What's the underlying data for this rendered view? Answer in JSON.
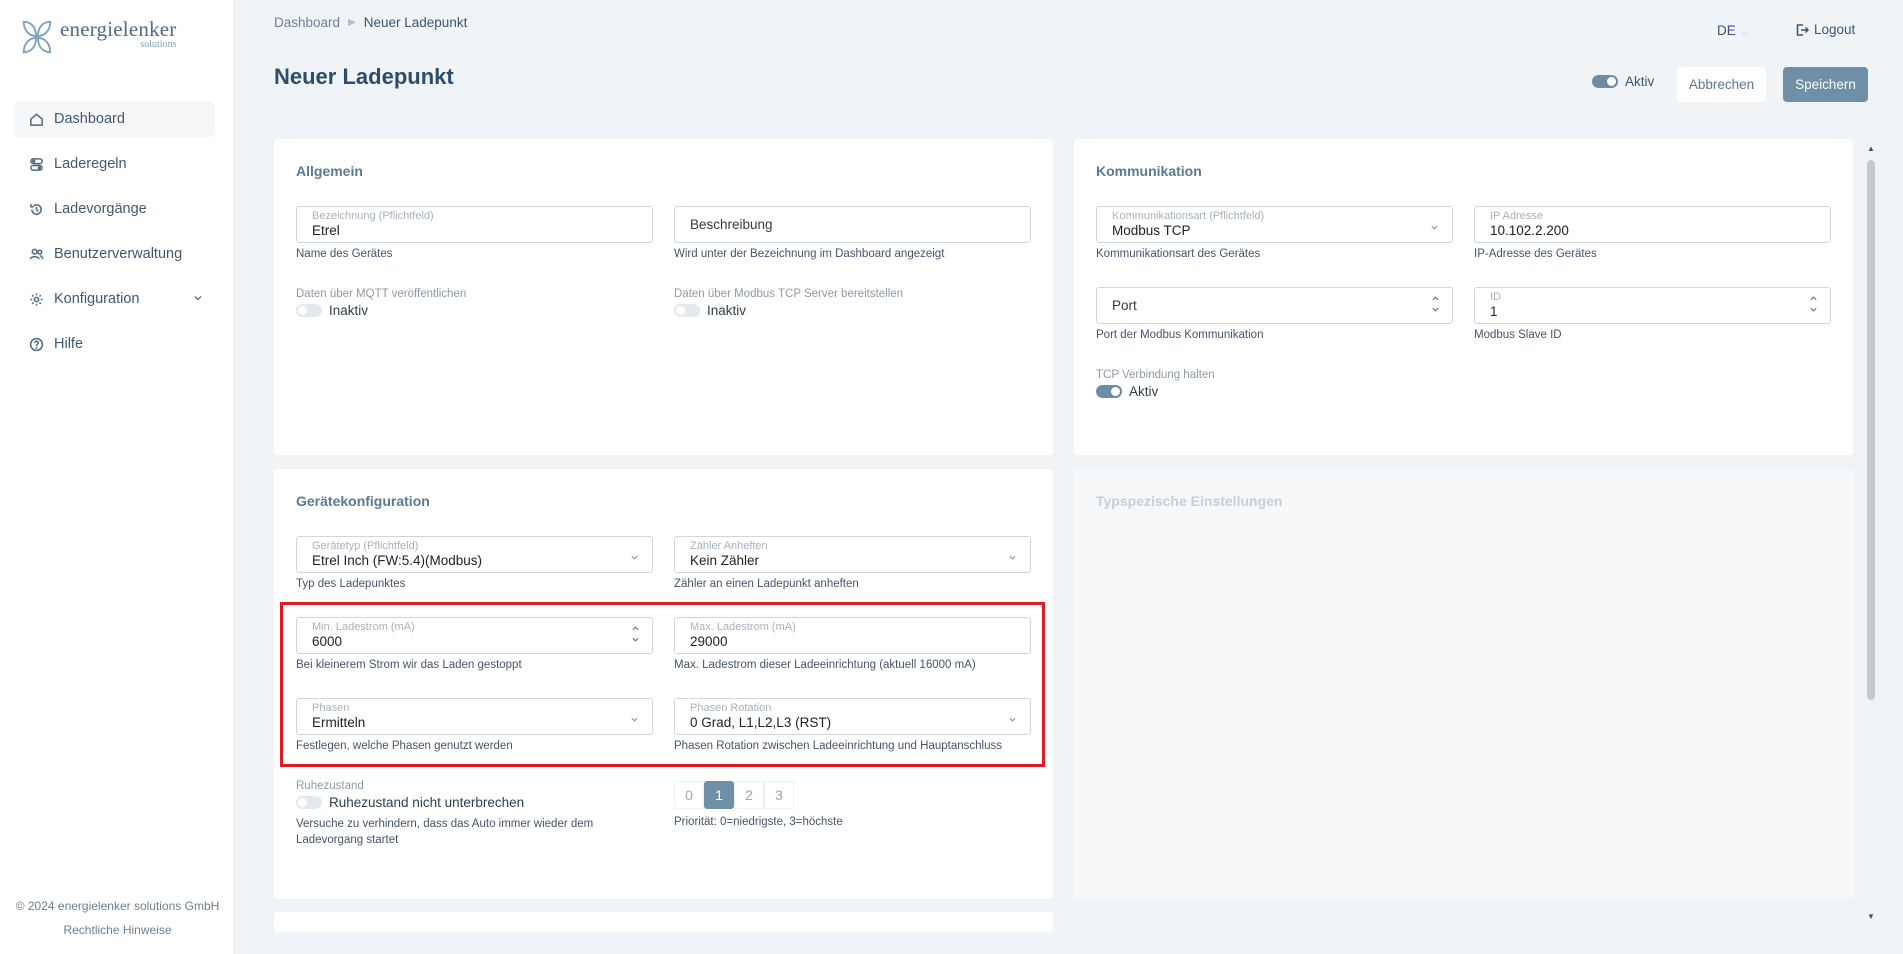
{
  "brand": {
    "name": "energielenker",
    "sub": "solutions"
  },
  "nav": [
    {
      "label": "Dashboard",
      "icon": "home-icon"
    },
    {
      "label": "Laderegeln",
      "icon": "rules-icon"
    },
    {
      "label": "Ladevorgänge",
      "icon": "history-icon"
    },
    {
      "label": "Benutzerverwaltung",
      "icon": "users-icon"
    },
    {
      "label": "Konfiguration",
      "icon": "gear-icon"
    },
    {
      "label": "Hilfe",
      "icon": "help-icon"
    }
  ],
  "footer": {
    "copyright": "© 2024 energielenker solutions GmbH",
    "legal": "Rechtliche Hinweise"
  },
  "breadcrumb": {
    "root": "Dashboard",
    "current": "Neuer Ladepunkt"
  },
  "header": {
    "lang": "DE",
    "logout": "Logout",
    "title": "Neuer Ladepunkt",
    "active_label": "Aktiv",
    "cancel": "Abbrechen",
    "save": "Speichern"
  },
  "allgemein": {
    "title": "Allgemein",
    "bezeichnung": {
      "label": "Bezeichnung (Pflichtfeld)",
      "value": "Etrel",
      "help": "Name des Gerätes"
    },
    "beschreibung": {
      "placeholder": "Beschreibung",
      "help": "Wird unter der Bezeichnung im Dashboard angezeigt"
    },
    "mqtt": {
      "label": "Daten über MQTT veröffentlichen",
      "state": "Inaktiv"
    },
    "modbus_server": {
      "label": "Daten über Modbus TCP Server bereitstellen",
      "state": "Inaktiv"
    }
  },
  "kommunikation": {
    "title": "Kommunikation",
    "art": {
      "label": "Kommunikationsart (Pflichtfeld)",
      "value": "Modbus TCP",
      "help": "Kommunikationsart des Gerätes"
    },
    "ip": {
      "label": "IP Adresse",
      "value": "10.102.2.200",
      "help": "IP-Adresse des Gerätes"
    },
    "port": {
      "placeholder": "Port",
      "help": "Port der Modbus Kommunikation"
    },
    "id": {
      "label": "ID",
      "value": "1",
      "help": "Modbus Slave ID"
    },
    "tcp": {
      "label": "TCP Verbindung halten",
      "state": "Aktiv"
    }
  },
  "geraet": {
    "title": "Gerätekonfiguration",
    "typ": {
      "label": "Gerätetyp (Pflichtfeld)",
      "value": "Etrel Inch (FW:5.4)(Modbus)",
      "help": "Typ des Ladepunktes"
    },
    "zaehler": {
      "label": "Zähler Anheften",
      "value": "Kein Zähler",
      "help": "Zähler an einen Ladepunkt anheften"
    },
    "min": {
      "label": "Min. Ladestrom (mA)",
      "value": "6000",
      "help": "Bei kleinerem Strom wir das Laden gestoppt"
    },
    "max": {
      "label": "Max. Ladestrom (mA)",
      "value": "29000",
      "help": "Max. Ladestrom dieser Ladeeinrichtung (aktuell 16000 mA)"
    },
    "phasen": {
      "label": "Phasen",
      "value": "Ermitteln",
      "help": "Festlegen, welche Phasen genutzt werden"
    },
    "rotation": {
      "label": "Phasen Rotation",
      "value": "0 Grad, L1,L2,L3 (RST)",
      "help": "Phasen Rotation zwischen Ladeeinrichtung und Hauptanschluss"
    },
    "ruhe": {
      "label": "Ruhezustand",
      "state": "Ruhezustand nicht unterbrechen",
      "help": "Versuche zu verhindern, dass das Auto immer wieder dem Ladevorgang startet"
    },
    "prio": {
      "options": [
        "0",
        "1",
        "2",
        "3"
      ],
      "selected": "1",
      "help": "Priorität: 0=niedrigste, 3=höchste"
    }
  },
  "typspezifisch": {
    "title": "Typspezische Einstellungen"
  },
  "colors": {
    "accent": "#6f8fa6",
    "highlight": "#e01b24",
    "title": "#2c4e6c"
  }
}
